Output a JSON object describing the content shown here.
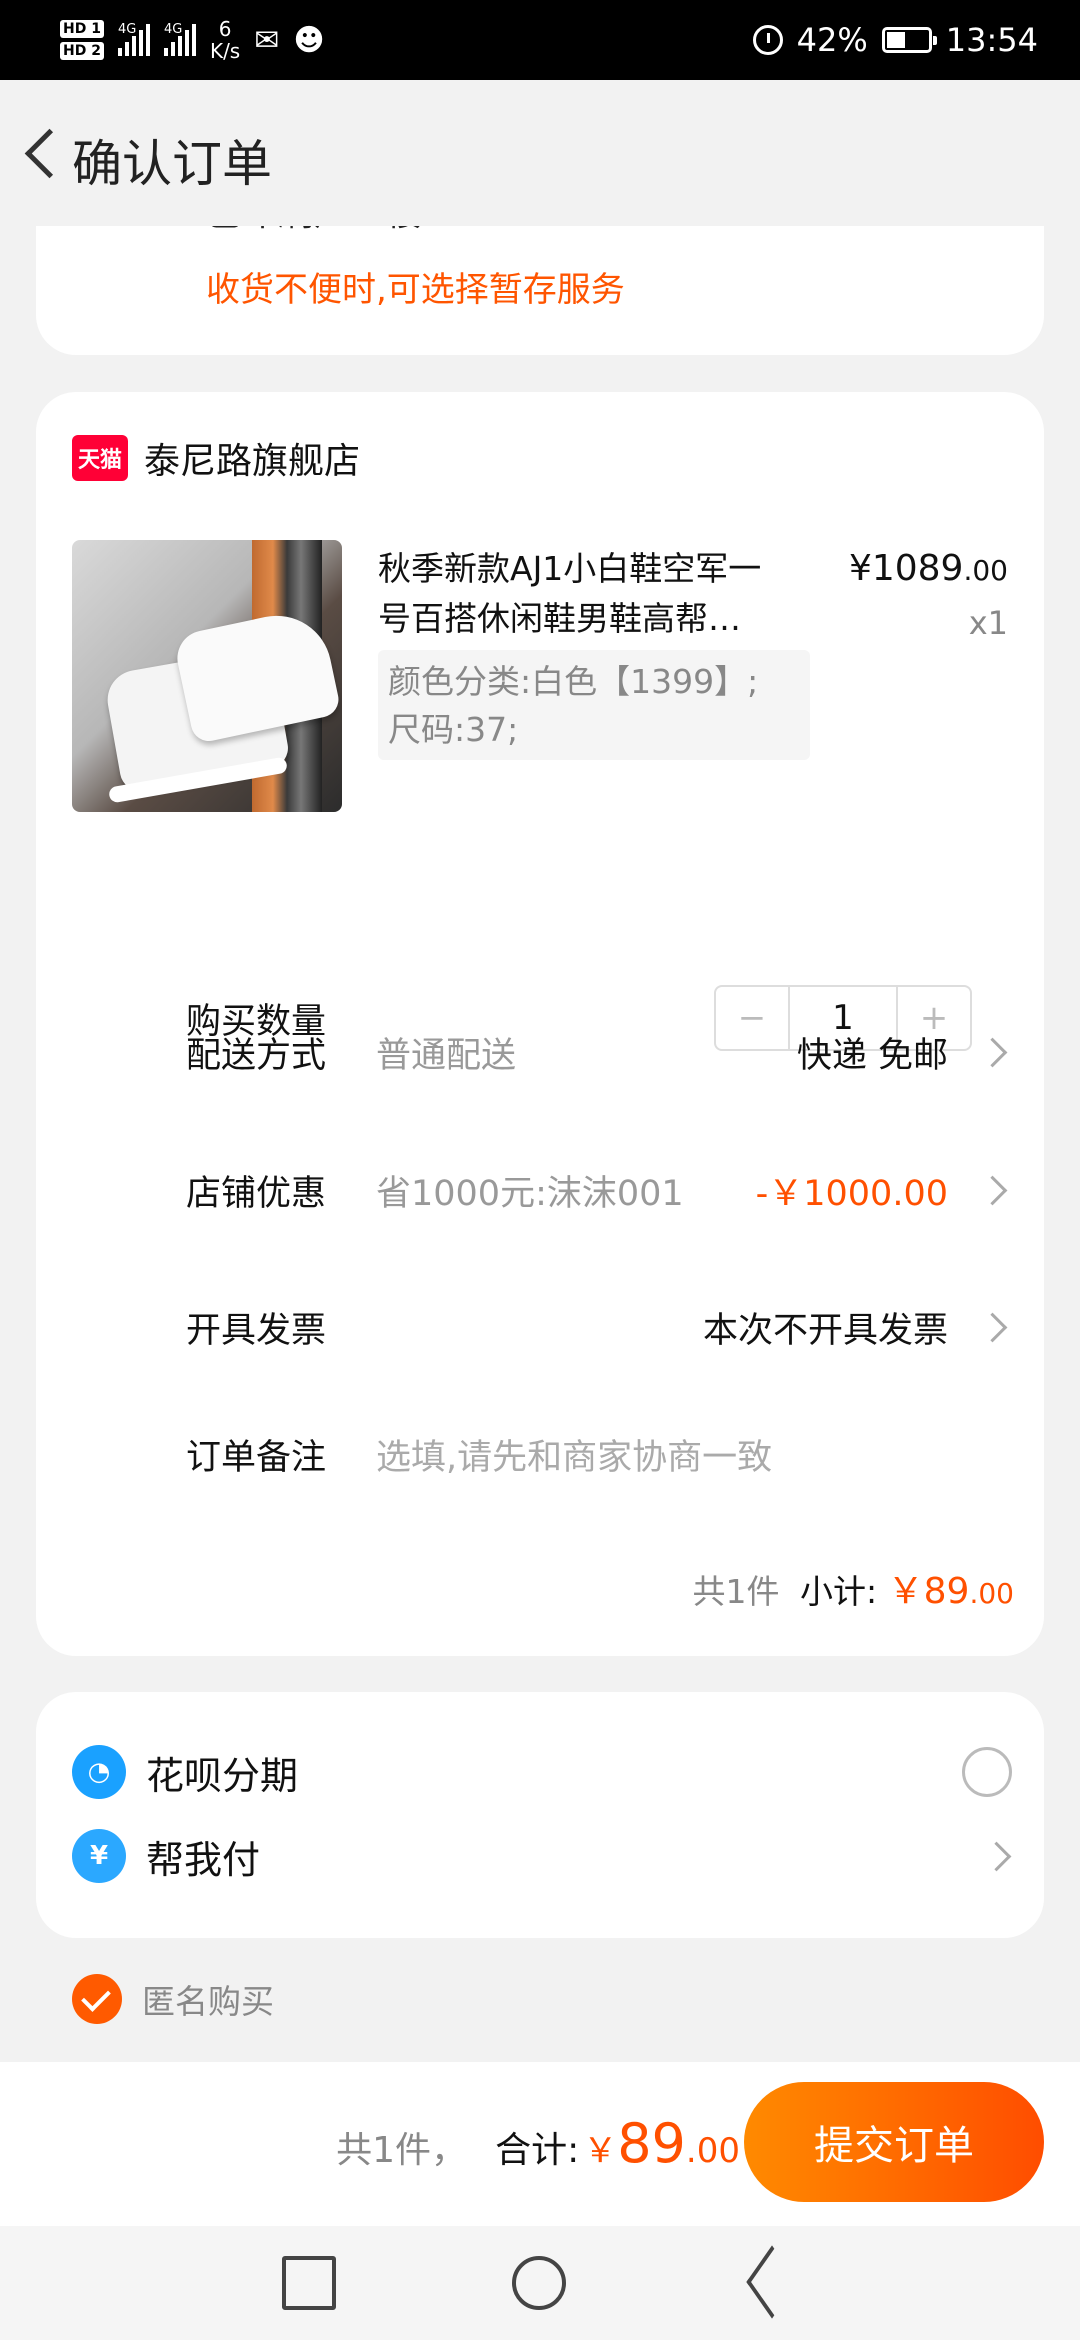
{
  "status_bar": {
    "hd1": "HD 1",
    "hd2": "HD 2",
    "net1": "4G",
    "net2": "4G",
    "speed_value": "6",
    "speed_unit": "K/s",
    "battery": "42%",
    "time": "13:54"
  },
  "header": {
    "title": "确认订单"
  },
  "address": {
    "partial_line": "巴印刷厂二楼",
    "hint": "收货不便时,可选择暂存服务"
  },
  "order": {
    "platform_badge": "天猫",
    "shop_name": "泰尼路旗舰店",
    "product": {
      "title_line1": "秋季新款AJ1小白鞋空军一",
      "title_line2": "号百搭休闲鞋男鞋高帮…",
      "sku_line1": "颜色分类:白色【1399】;",
      "sku_line2": "尺码:37;",
      "price_main": "¥1089",
      "price_decimal": ".00",
      "quantity": "x1"
    },
    "quantity_row": {
      "label": "购买数量",
      "minus": "−",
      "value": "1",
      "plus": "+"
    },
    "delivery_row": {
      "label": "配送方式",
      "mid": "普通配送",
      "value": "快递 免邮"
    },
    "discount_row": {
      "label": "店铺优惠",
      "mid": "省1000元:沫沫001",
      "value": "-￥1000.00"
    },
    "invoice_row": {
      "label": "开具发票",
      "value": "本次不开具发票"
    },
    "note_row": {
      "label": "订单备注",
      "placeholder": "选填,请先和商家协商一致"
    },
    "subtotal": {
      "count": "共1件",
      "label": "小计:",
      "amount": "￥89",
      "decimal": ".00"
    }
  },
  "payment": {
    "huabei": {
      "label": "花呗分期",
      "icon": "huabei-icon"
    },
    "help_pay": {
      "label": "帮我付",
      "icon": "yen-icon",
      "icon_glyph": "¥"
    }
  },
  "anonymous": {
    "label": "匿名购买",
    "checked": true
  },
  "bottom_bar": {
    "count": "共1件，",
    "total_label": "合计:",
    "yen": "￥",
    "amount": "89",
    "decimal": ".00",
    "submit_label": "提交订单"
  },
  "colors": {
    "accent": "#ff5000",
    "button_gradient_start": "#ff8a00",
    "button_gradient_end": "#ff4d00",
    "tmall_red": "#ff0036"
  }
}
